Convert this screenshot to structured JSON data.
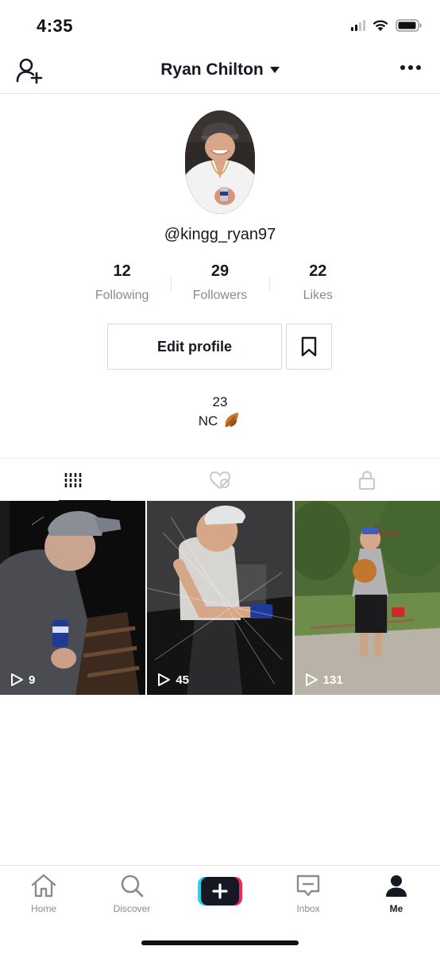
{
  "status_bar": {
    "time": "4:35"
  },
  "header": {
    "title": "Ryan Chilton",
    "add_user_icon": "add-user-icon",
    "more_icon": "more-icon"
  },
  "profile": {
    "username": "@kingg_ryan97",
    "stats": [
      {
        "value": "12",
        "label": "Following"
      },
      {
        "value": "29",
        "label": "Followers"
      },
      {
        "value": "22",
        "label": "Likes"
      }
    ],
    "edit_button_label": "Edit profile",
    "bio_line1": "23",
    "bio_line2": "NC"
  },
  "tabs": [
    {
      "icon": "videos-grid-icon",
      "active": true
    },
    {
      "icon": "liked-videos-icon",
      "active": false
    },
    {
      "icon": "private-lock-icon",
      "active": false
    }
  ],
  "videos": [
    {
      "views": "9"
    },
    {
      "views": "45"
    },
    {
      "views": "131"
    }
  ],
  "bottom_nav": [
    {
      "label": "Home",
      "icon": "home-icon"
    },
    {
      "label": "Discover",
      "icon": "search-icon"
    },
    {
      "label": "",
      "icon": "create-plus-icon"
    },
    {
      "label": "Inbox",
      "icon": "inbox-icon"
    },
    {
      "label": "Me",
      "icon": "profile-icon",
      "active": true
    }
  ],
  "colors": {
    "text": "#161823",
    "muted": "#8a8b91",
    "accent_cyan": "#20d5ec",
    "accent_pink": "#ef2950"
  }
}
